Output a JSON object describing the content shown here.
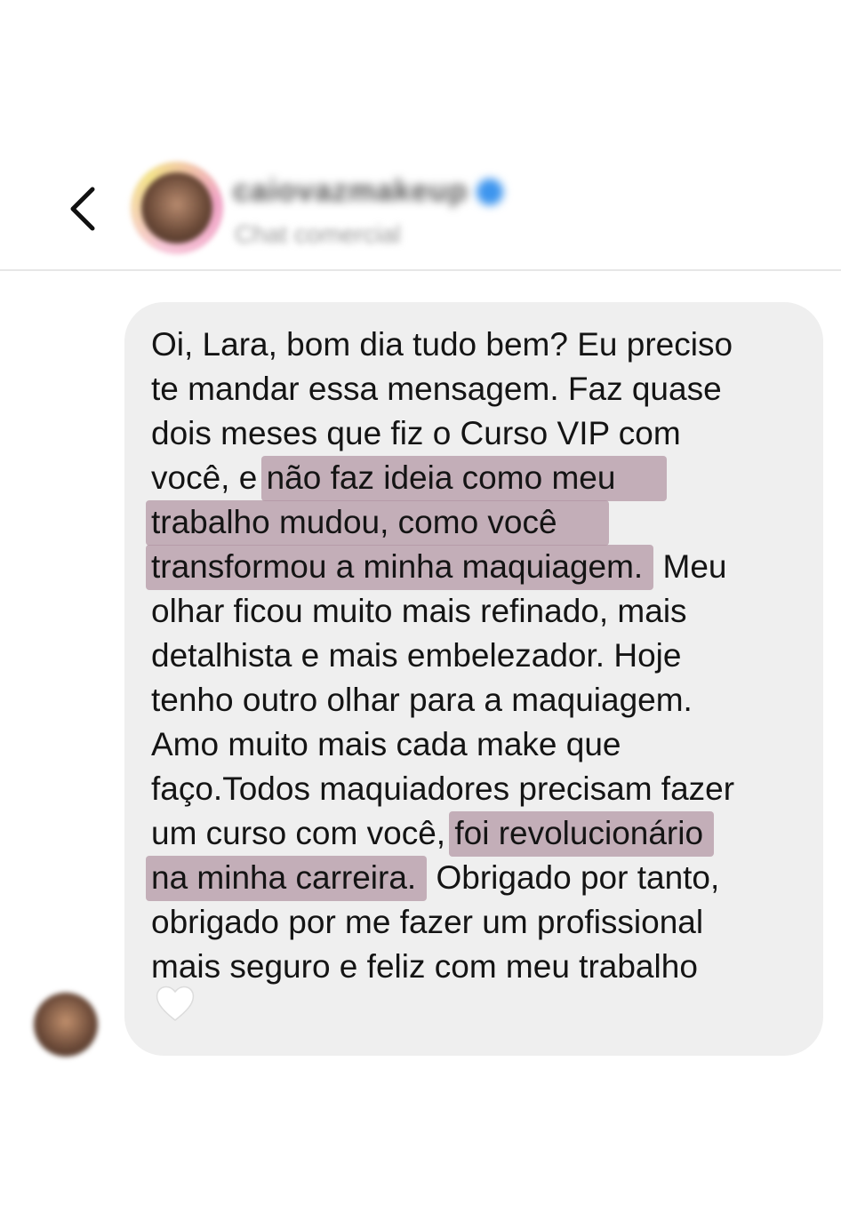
{
  "header": {
    "back_icon": "chevron-left-icon",
    "username": "caiovazmakeup",
    "subtitle": "Chat comercial",
    "verified_color": "#3d95ee"
  },
  "message": {
    "lines": [
      "Oi, Lara, bom dia tudo bem? Eu preciso",
      "te mandar essa mensagem. Faz quase",
      "dois meses que fiz o Curso VIP com",
      "você, e ",
      "não faz ideia como meu",
      "trabalho mudou, como você",
      "transformou a minha maquiagem.",
      " Meu",
      "olhar ficou muito mais refinado, mais",
      "detalhista e mais embelezador. Hoje",
      "tenho outro olhar para a maquiagem.",
      "Amo muito mais cada make que",
      "faço.Todos maquiadores precisam fazer",
      "um curso com você, ",
      "foi revolucionário",
      "na minha carreira.",
      " Obrigado por tanto,",
      "obrigado por me fazer um profissional",
      "mais seguro e feliz com meu trabalho"
    ],
    "reaction_icon": "white-heart-icon",
    "bubble_color": "#efefef",
    "highlight_color": "#b294a2"
  }
}
